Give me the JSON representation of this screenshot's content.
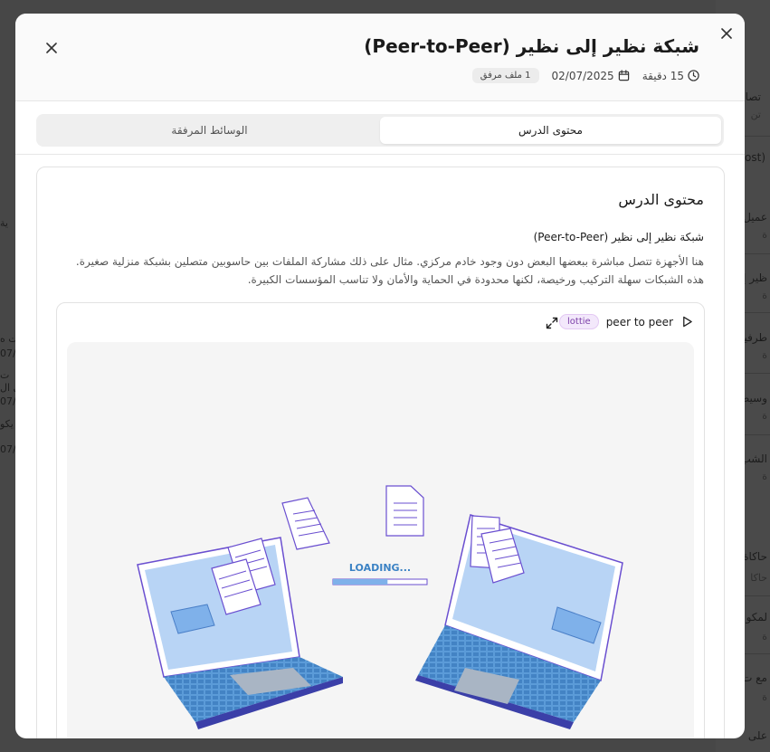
{
  "modal": {
    "title": "شبكة نظير إلى نظير (Peer-to-Peer)",
    "duration": "15 دقيقة",
    "date": "02/07/2025",
    "attachments_badge": "1 ملف مرفق"
  },
  "tabs": [
    {
      "label": "محتوى الدرس",
      "active": true
    },
    {
      "label": "الوسائط المرفقة",
      "active": false
    }
  ],
  "content": {
    "card_title": "محتوى الدرس",
    "heading": "شبكة نظير إلى نظير (Peer-to-Peer)",
    "body": "هنا الأجهزة تتصل مباشرة ببعضها البعض دون وجود خادم مركزي. مثال على ذلك مشاركة الملفات بين حاسوبين متصلين بشبكة منزلية صغيرة. هذه الشبكات سهلة التركيب ورخيصة، لكنها محدودة في الحماية والأمان ولا تناسب المؤسسات الكبيرة."
  },
  "media": {
    "name": "peer to peer",
    "type_badge": "lottie",
    "loading_text": "LOADING...",
    "loading_progress": 0.58
  },
  "colors": {
    "accent_purple": "#6a4fd0",
    "screen_blue": "#b8d4f5",
    "keyboard_blue": "#3b82c4",
    "folder_blue": "#7fb1ea"
  },
  "background": {
    "right_items": [
      {
        "text": "تصال",
        "sub": "تن"
      },
      {
        "text": "ost)",
        "sub": ""
      },
      {
        "text": "عميل",
        "sub": "ة"
      },
      {
        "text": "ظير إ",
        "sub": "ة"
      },
      {
        "text": "طرفية",
        "sub": "ة"
      },
      {
        "text": "وسيط",
        "sub": "ة"
      },
      {
        "text": "الشب",
        "sub": "ة"
      },
      {
        "text": "حاكاة",
        "sub": "حاكا"
      },
      {
        "text": "لمكو",
        "sub": "ة"
      },
      {
        "text": "مع ت",
        "sub": "ة"
      },
      {
        "text": "على",
        "sub": ""
      }
    ],
    "left_items": [
      {
        "text": "ية"
      },
      {
        "text": "ت ه"
      },
      {
        "text": "07/"
      },
      {
        "text": "ت"
      },
      {
        "text": "ي ال"
      },
      {
        "text": "07/"
      },
      {
        "text": "يكو"
      },
      {
        "text": "07/"
      }
    ]
  }
}
